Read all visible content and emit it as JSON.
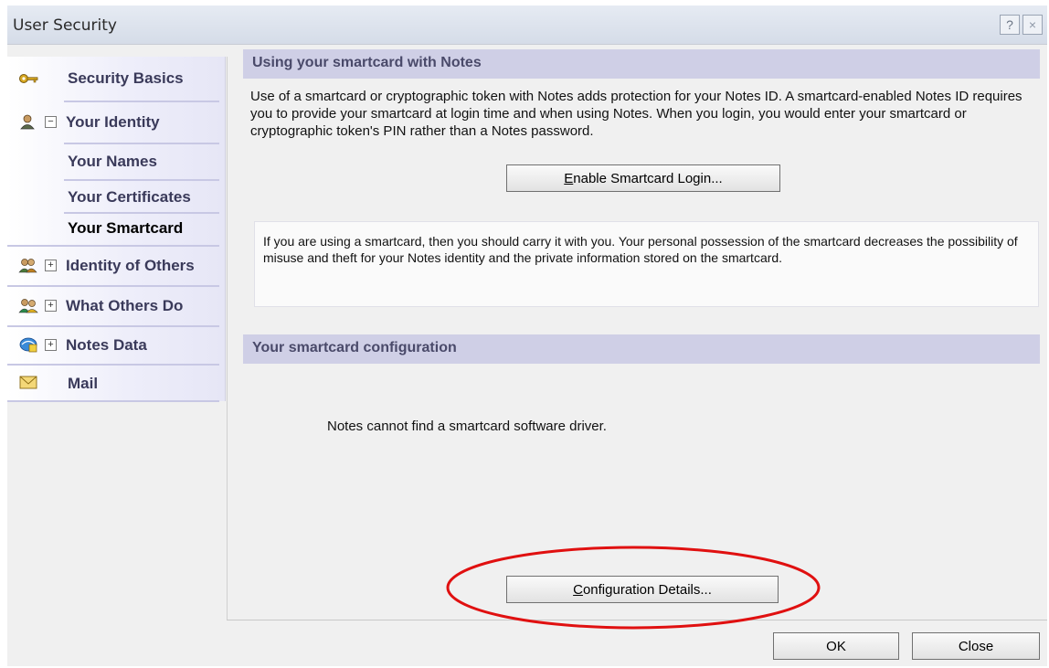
{
  "window": {
    "title": "User Security",
    "help_symbol": "?",
    "close_symbol": "×"
  },
  "nav": {
    "items": [
      {
        "label": "Security Basics",
        "icon": "key-icon",
        "expander": ""
      },
      {
        "label": "Your Identity",
        "icon": "identity-person-icon",
        "expander": "−"
      },
      {
        "label": "Your Names",
        "icon": "",
        "expander": ""
      },
      {
        "label": "Your Certificates",
        "icon": "",
        "expander": ""
      },
      {
        "label": "Your Smartcard",
        "icon": "",
        "expander": "",
        "selected": true
      },
      {
        "label": "Identity of Others",
        "icon": "people-icon",
        "expander": "+"
      },
      {
        "label": "What Others Do",
        "icon": "people-group-icon",
        "expander": "+"
      },
      {
        "label": "Notes Data",
        "icon": "notes-data-icon",
        "expander": "+"
      },
      {
        "label": "Mail",
        "icon": "mail-envelope-icon",
        "expander": ""
      }
    ]
  },
  "smartcard_section": {
    "header": "Using your smartcard with Notes",
    "description": "Use of a smartcard or cryptographic token with Notes adds protection for your Notes ID.  A smartcard-enabled Notes ID requires you to provide your smartcard at login time and when using Notes.  When you login, you would enter your smartcard or cryptographic token's PIN rather than a Notes password.",
    "enable_button": {
      "prefix": "",
      "mnemonic": "E",
      "rest": "nable Smartcard Login..."
    },
    "info": "If you are using a smartcard, then you should carry it with you.  Your personal possession of the smartcard decreases the possibility of misuse and theft for your Notes identity and the private information stored on the smartcard."
  },
  "config_section": {
    "header": "Your smartcard configuration",
    "message": "Notes cannot find a smartcard software driver.",
    "details_button": {
      "mnemonic": "C",
      "rest": "onfiguration Details..."
    }
  },
  "footer": {
    "ok_label": "OK",
    "close_label": "Close"
  },
  "annotation": {
    "highlight_color": "#e01010"
  }
}
